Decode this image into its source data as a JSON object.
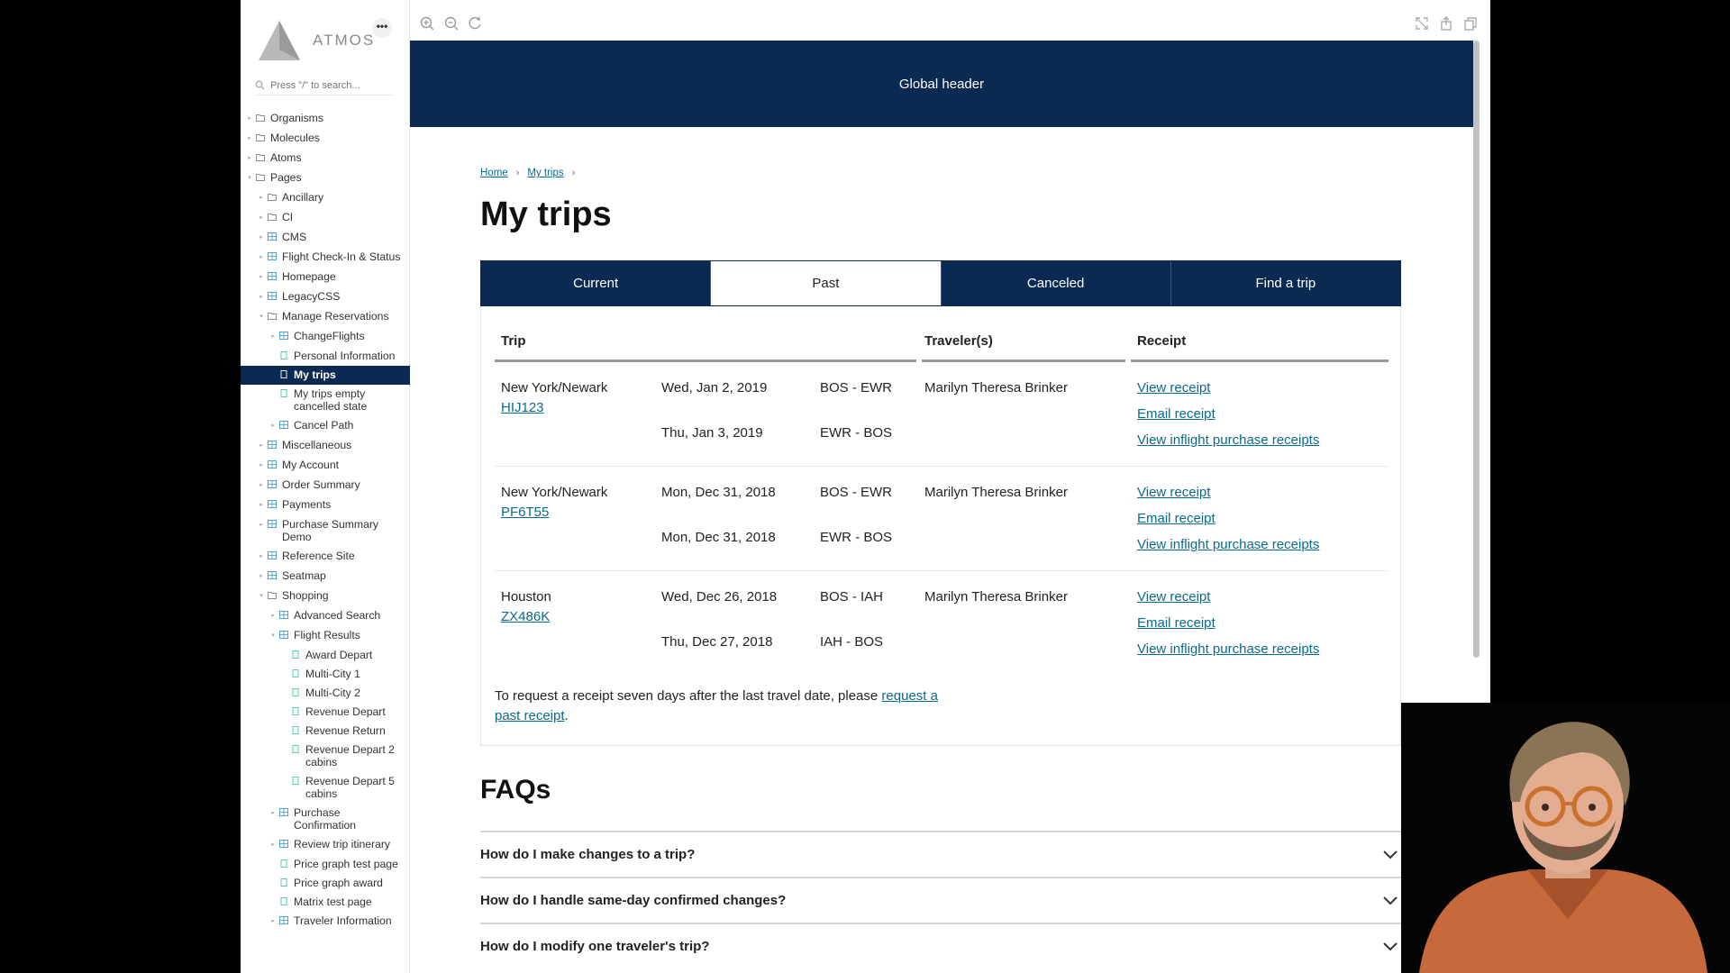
{
  "brand": {
    "name": "ATMOS",
    "more_label": "•••"
  },
  "search": {
    "placeholder": "Press \"/\" to search..."
  },
  "tree": [
    {
      "label": "Organisms",
      "level": 0,
      "arrow": "▸",
      "icon": "folder"
    },
    {
      "label": "Molecules",
      "level": 0,
      "arrow": "▸",
      "icon": "folder"
    },
    {
      "label": "Atoms",
      "level": 0,
      "arrow": "▸",
      "icon": "folder"
    },
    {
      "label": "Pages",
      "level": 0,
      "arrow": "▾",
      "icon": "folder"
    },
    {
      "label": "Ancillary",
      "level": 1,
      "arrow": "▸",
      "icon": "folder"
    },
    {
      "label": "CI",
      "level": 1,
      "arrow": "▸",
      "icon": "folder"
    },
    {
      "label": "CMS",
      "level": 1,
      "arrow": "▸",
      "icon": "component"
    },
    {
      "label": "Flight Check-In & Status",
      "level": 1,
      "arrow": "▸",
      "icon": "component"
    },
    {
      "label": "Homepage",
      "level": 1,
      "arrow": "▸",
      "icon": "component"
    },
    {
      "label": "LegacyCSS",
      "level": 1,
      "arrow": "▸",
      "icon": "component"
    },
    {
      "label": "Manage Reservations",
      "level": 1,
      "arrow": "▾",
      "icon": "folder"
    },
    {
      "label": "ChangeFlights",
      "level": 2,
      "arrow": "▸",
      "icon": "component"
    },
    {
      "label": "Personal Information",
      "level": 2,
      "arrow": "",
      "icon": "story"
    },
    {
      "label": "My trips",
      "level": 2,
      "arrow": "",
      "icon": "story",
      "active": true
    },
    {
      "label": "My trips empty cancelled state",
      "level": 2,
      "arrow": "",
      "icon": "story"
    },
    {
      "label": "Cancel Path",
      "level": 2,
      "arrow": "▸",
      "icon": "component"
    },
    {
      "label": "Miscellaneous",
      "level": 1,
      "arrow": "▸",
      "icon": "component"
    },
    {
      "label": "My Account",
      "level": 1,
      "arrow": "▸",
      "icon": "component"
    },
    {
      "label": "Order Summary",
      "level": 1,
      "arrow": "▸",
      "icon": "component"
    },
    {
      "label": "Payments",
      "level": 1,
      "arrow": "▸",
      "icon": "component"
    },
    {
      "label": "Purchase Summary Demo",
      "level": 1,
      "arrow": "▸",
      "icon": "component"
    },
    {
      "label": "Reference Site",
      "level": 1,
      "arrow": "▸",
      "icon": "component"
    },
    {
      "label": "Seatmap",
      "level": 1,
      "arrow": "▸",
      "icon": "component"
    },
    {
      "label": "Shopping",
      "level": 1,
      "arrow": "▾",
      "icon": "folder"
    },
    {
      "label": "Advanced Search",
      "level": 2,
      "arrow": "▸",
      "icon": "component"
    },
    {
      "label": "Flight Results",
      "level": 2,
      "arrow": "▾",
      "icon": "component"
    },
    {
      "label": "Award Depart",
      "level": 3,
      "arrow": "",
      "icon": "story"
    },
    {
      "label": "Multi-City 1",
      "level": 3,
      "arrow": "",
      "icon": "story"
    },
    {
      "label": "Multi-City 2",
      "level": 3,
      "arrow": "",
      "icon": "story"
    },
    {
      "label": "Revenue Depart",
      "level": 3,
      "arrow": "",
      "icon": "story"
    },
    {
      "label": "Revenue Return",
      "level": 3,
      "arrow": "",
      "icon": "story"
    },
    {
      "label": "Revenue Depart 2 cabins",
      "level": 3,
      "arrow": "",
      "icon": "story"
    },
    {
      "label": "Revenue Depart 5 cabins",
      "level": 3,
      "arrow": "",
      "icon": "story"
    },
    {
      "label": "Purchase Confirmation",
      "level": 2,
      "arrow": "▸",
      "icon": "component"
    },
    {
      "label": "Review trip itinerary",
      "level": 2,
      "arrow": "▸",
      "icon": "component"
    },
    {
      "label": "Price graph test page",
      "level": 2,
      "arrow": "",
      "icon": "story"
    },
    {
      "label": "Price graph award",
      "level": 2,
      "arrow": "",
      "icon": "story"
    },
    {
      "label": "Matrix test page",
      "level": 2,
      "arrow": "",
      "icon": "story"
    },
    {
      "label": "Traveler Information",
      "level": 2,
      "arrow": "▸",
      "icon": "component"
    }
  ],
  "toolbar": {
    "left_icons": [
      "zoom-in-icon",
      "zoom-out-icon",
      "zoom-reset-icon"
    ],
    "right_icons": [
      "fullscreen-icon",
      "share-icon",
      "copy-icon"
    ]
  },
  "global_header": {
    "label": "Global header"
  },
  "breadcrumb": {
    "home": "Home",
    "current": "My trips",
    "sep": "›"
  },
  "page": {
    "title": "My trips"
  },
  "tabs": [
    {
      "label": "Current",
      "selected": false
    },
    {
      "label": "Past",
      "selected": true
    },
    {
      "label": "Canceled",
      "selected": false
    },
    {
      "label": "Find a trip",
      "selected": false
    }
  ],
  "table": {
    "headers": {
      "trip": "Trip",
      "travelers": "Traveler(s)",
      "receipt": "Receipt"
    },
    "rows": [
      {
        "city": "New York/Newark",
        "code": "HIJ123",
        "date1": "Wed, Jan 2, 2019",
        "route1": "BOS - EWR",
        "date2": "Thu, Jan 3, 2019",
        "route2": "EWR - BOS",
        "traveler": "Marilyn Theresa Brinker",
        "links": [
          "View receipt",
          "Email receipt",
          "View inflight purchase receipts"
        ]
      },
      {
        "city": "New York/Newark",
        "code": "PF6T55",
        "date1": "Mon, Dec 31, 2018",
        "route1": "BOS - EWR",
        "date2": "Mon, Dec 31, 2018",
        "route2": "EWR - BOS",
        "traveler": "Marilyn Theresa Brinker",
        "links": [
          "View receipt",
          "Email receipt",
          "View inflight purchase receipts"
        ]
      },
      {
        "city": "Houston",
        "code": "ZX486K",
        "date1": "Wed, Dec 26, 2018",
        "route1": "BOS - IAH",
        "date2": "Thu, Dec 27, 2018",
        "route2": "IAH - BOS",
        "traveler": "Marilyn Theresa Brinker",
        "links": [
          "View receipt",
          "Email receipt",
          "View inflight purchase receipts"
        ]
      }
    ],
    "note_prefix": "To request a receipt seven days after the last travel date, please ",
    "note_link": "request a past receipt",
    "note_suffix": "."
  },
  "faq": {
    "title": "FAQs",
    "items": [
      "How do I make changes to a trip?",
      "How do I handle same-day confirmed changes?",
      "How do I modify one traveler's trip?"
    ]
  },
  "colors": {
    "brand_navy": "#0a2a52",
    "link": "#0a6a8c",
    "background": "#ffffff"
  }
}
